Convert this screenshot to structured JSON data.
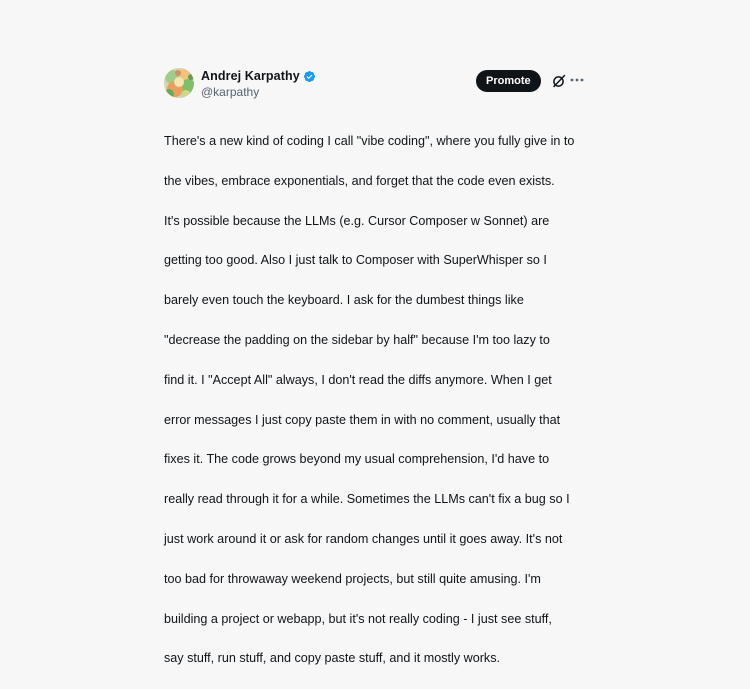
{
  "author": {
    "display_name": "Andrej Karpathy",
    "handle": "@karpathy",
    "verified_icon": "verified-badge-icon",
    "avatar": "avatar-image"
  },
  "actions": {
    "promote_label": "Promote",
    "grok_icon": "grok-icon",
    "more_icon": "more-dots-icon"
  },
  "tweet": {
    "lines": [
      "There's a new kind of coding I call \"vibe coding\", where you fully give in to",
      "the vibes, embrace exponentials, and forget that the code even exists.",
      "It's possible because the LLMs (e.g. Cursor Composer w Sonnet) are",
      "getting too good. Also I just talk to Composer with SuperWhisper so I",
      "barely even touch the keyboard. I ask for the dumbest things like",
      "\"decrease the padding on the sidebar by half\" because I'm too lazy to",
      "find it. I \"Accept All\" always, I don't read the diffs anymore. When I get",
      "error messages I just copy paste them in with no comment, usually that",
      "fixes it. The code grows beyond my usual comprehension, I'd have to",
      "really read through it for a while. Sometimes the LLMs can't fix a bug so I",
      "just work around it or ask for random changes until it goes away. It's not",
      "too bad for throwaway weekend projects, but still quite amusing. I'm",
      "building a project or webapp, but it's not really coding - I just see stuff,",
      "say stuff, run stuff, and copy paste stuff, and it mostly works."
    ]
  },
  "colors": {
    "background": "#f7f7f7",
    "text": "#0f1419",
    "secondary_text": "#536471",
    "verified_blue": "#1d9bf0",
    "promote_bg": "#0f1419"
  }
}
